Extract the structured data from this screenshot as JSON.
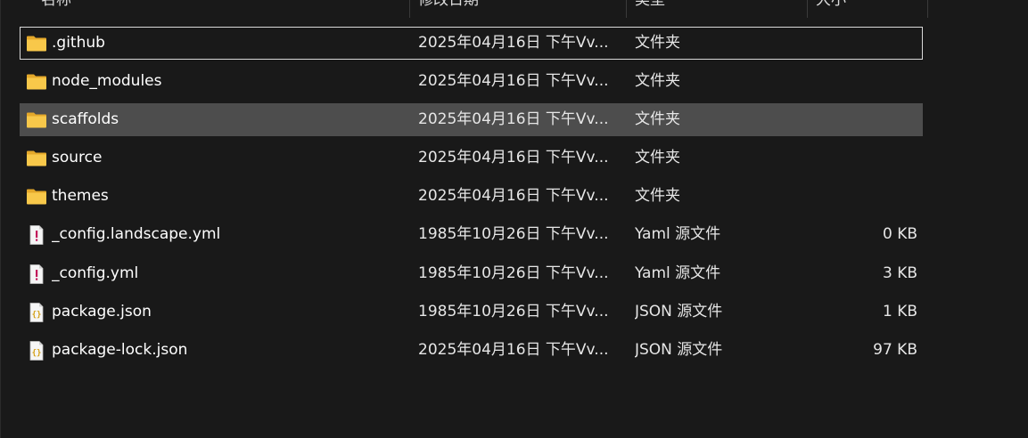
{
  "columns": {
    "name": "名称",
    "date": "修改日期",
    "type": "类型",
    "size": "大小"
  },
  "colors": {
    "background": "#191919",
    "selected_row": "#4d4d4d",
    "focus_border": "#d9d9d9",
    "folder_yellow": "#f5c13e"
  },
  "files": [
    {
      "name": ".github",
      "date": "2025年04月16日 下午Vv...",
      "type": "文件夹",
      "size": "",
      "icon": "folder-icon"
    },
    {
      "name": "node_modules",
      "date": "2025年04月16日 下午Vv...",
      "type": "文件夹",
      "size": "",
      "icon": "folder-icon"
    },
    {
      "name": "scaffolds",
      "date": "2025年04月16日 下午Vv...",
      "type": "文件夹",
      "size": "",
      "icon": "folder-icon"
    },
    {
      "name": "source",
      "date": "2025年04月16日 下午Vv...",
      "type": "文件夹",
      "size": "",
      "icon": "folder-icon"
    },
    {
      "name": "themes",
      "date": "2025年04月16日 下午Vv...",
      "type": "文件夹",
      "size": "",
      "icon": "folder-icon"
    },
    {
      "name": "_config.landscape.yml",
      "date": "1985年10月26日 下午Vv...",
      "type": "Yaml 源文件",
      "size": "0 KB",
      "icon": "yaml-file-icon"
    },
    {
      "name": "_config.yml",
      "date": "1985年10月26日 下午Vv...",
      "type": "Yaml 源文件",
      "size": "3 KB",
      "icon": "yaml-file-icon"
    },
    {
      "name": "package.json",
      "date": "1985年10月26日 下午Vv...",
      "type": "JSON 源文件",
      "size": "1 KB",
      "icon": "json-file-icon"
    },
    {
      "name": "package-lock.json",
      "date": "2025年04月16日 下午Vv...",
      "type": "JSON 源文件",
      "size": "97 KB",
      "icon": "json-file-icon"
    }
  ]
}
